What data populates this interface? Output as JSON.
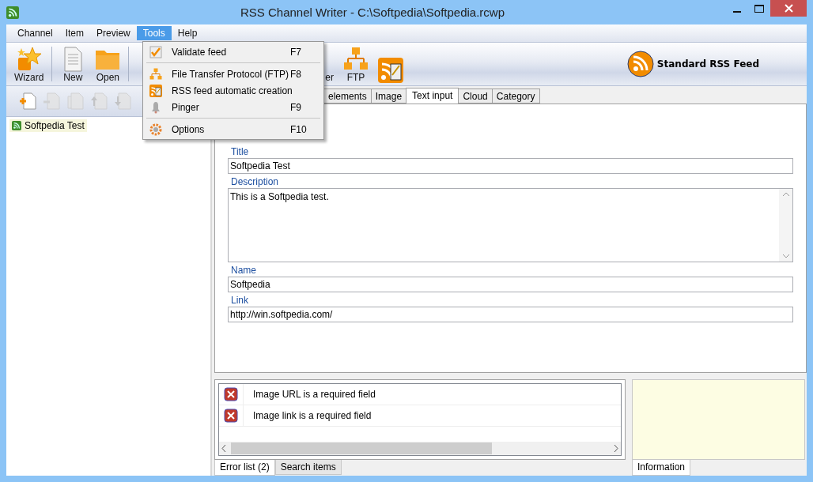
{
  "window": {
    "title": "RSS Channel Writer - C:\\Softpedia\\Softpedia.rcwp"
  },
  "menu": [
    {
      "label": "Channel",
      "selected": false
    },
    {
      "label": "Item",
      "selected": false
    },
    {
      "label": "Preview",
      "selected": false
    },
    {
      "label": "Tools",
      "selected": true
    },
    {
      "label": "Help",
      "selected": false
    }
  ],
  "dropdown": [
    {
      "kind": "item",
      "label": "Validate feed",
      "shortcut": "F7"
    },
    {
      "kind": "separator"
    },
    {
      "kind": "item",
      "label": "File Transfer Protocol (FTP)",
      "shortcut": "F8"
    },
    {
      "kind": "item",
      "label": "RSS feed automatic creation"
    },
    {
      "kind": "item",
      "label": "Pinger",
      "shortcut": "F9"
    },
    {
      "kind": "separator"
    },
    {
      "kind": "item",
      "label": "Options",
      "shortcut": "F10"
    }
  ],
  "toolbar": [
    {
      "label": "Wizard"
    },
    {
      "label": "New"
    },
    {
      "label": "Open"
    },
    {
      "label": "er"
    },
    {
      "label": "FTP"
    }
  ],
  "feed_type": "Standard RSS Feed",
  "item_tools": [
    {
      "disabled": false
    },
    {
      "disabled": true
    },
    {
      "disabled": true
    },
    {
      "disabled": true
    },
    {
      "disabled": true
    }
  ],
  "tree": [
    {
      "label": "Softpedia Test",
      "selected": true
    }
  ],
  "tabs": [
    {
      "label": "elements",
      "selected": false
    },
    {
      "label": "Image",
      "selected": false
    },
    {
      "label": "Text input",
      "selected": true
    },
    {
      "label": "Cloud",
      "selected": false
    },
    {
      "label": "Category",
      "selected": false
    }
  ],
  "form": [
    {
      "kind": "line",
      "label": "Title",
      "value": "Softpedia Test"
    },
    {
      "kind": "multiline",
      "label": "Description",
      "value": "This is a Softpedia test."
    },
    {
      "kind": "line",
      "label": "Name",
      "value": "Softpedia"
    },
    {
      "kind": "line",
      "label": "Link",
      "value": "http://win.softpedia.com/"
    }
  ],
  "errors": [
    "Image URL is a required field",
    "Image link is a required field"
  ],
  "bottom_tabs": [
    {
      "label": "Error list (2)",
      "selected": true
    },
    {
      "label": "Search items",
      "selected": false
    }
  ],
  "info_tabs": [
    {
      "label": "Information",
      "selected": true
    }
  ]
}
